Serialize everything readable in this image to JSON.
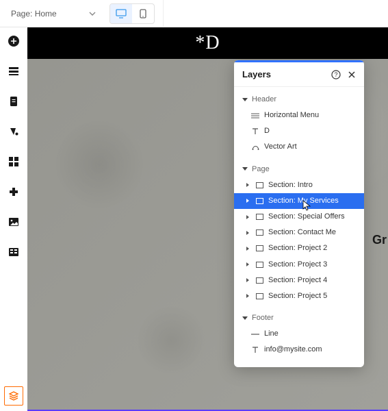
{
  "topbar": {
    "page_label_prefix": "Page:",
    "page_name": "Home"
  },
  "canvas": {
    "logo_text": "*D",
    "side_text": "Gr"
  },
  "panel": {
    "title": "Layers",
    "groups": {
      "header": {
        "label": "Header",
        "items": [
          {
            "icon": "menu",
            "label": "Horizontal Menu"
          },
          {
            "icon": "text",
            "label": "D"
          },
          {
            "icon": "vector",
            "label": "Vector Art"
          }
        ]
      },
      "page": {
        "label": "Page",
        "items": [
          {
            "label": "Section: Intro"
          },
          {
            "label": "Section: My Services",
            "selected": true
          },
          {
            "label": "Section: Special Offers"
          },
          {
            "label": "Section: Contact Me"
          },
          {
            "label": "Section: Project 2"
          },
          {
            "label": "Section: Project 3"
          },
          {
            "label": "Section: Project 4"
          },
          {
            "label": "Section: Project 5"
          }
        ]
      },
      "footer": {
        "label": "Footer",
        "items": [
          {
            "icon": "line",
            "label": "Line"
          },
          {
            "icon": "text",
            "label": "info@mysite.com"
          }
        ]
      }
    }
  }
}
